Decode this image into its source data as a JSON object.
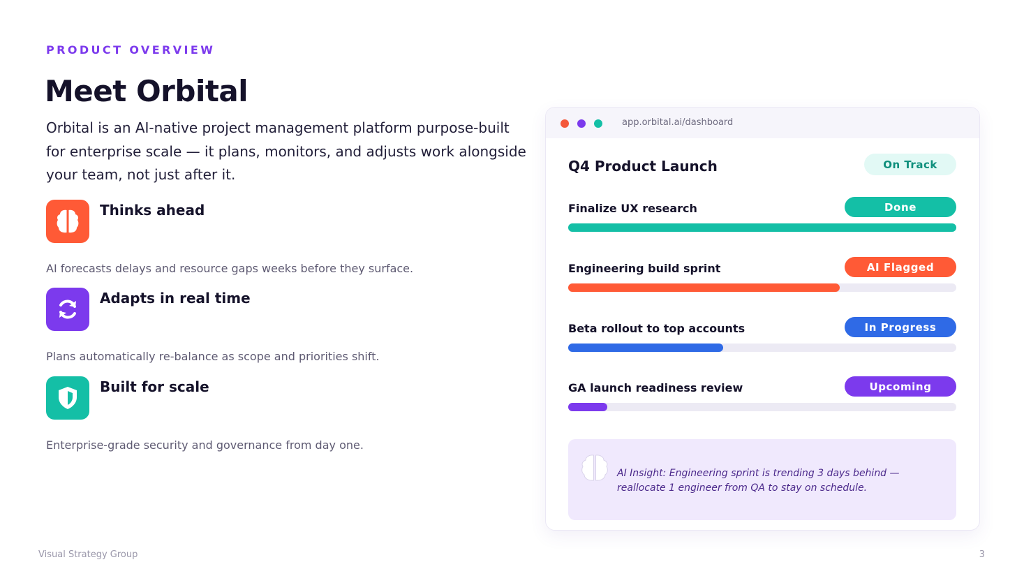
{
  "eyebrow": "PRODUCT OVERVIEW",
  "title": "Meet Orbital",
  "intro": "Orbital is an AI-native project management platform purpose-built for enterprise scale — it plans, monitors, and adjusts work alongside your team, not just after it.",
  "features": [
    {
      "title": "Thinks ahead",
      "desc": "AI forecasts delays and resource gaps weeks before they surface.",
      "icon": "brain-icon",
      "color": "#ff5a36"
    },
    {
      "title": "Adapts in real time",
      "desc": "Plans automatically re-balance as scope and priorities shift.",
      "icon": "refresh-icon",
      "color": "#7c3aed"
    },
    {
      "title": "Built for scale",
      "desc": "Enterprise-grade security and governance from day one.",
      "icon": "shield-icon",
      "color": "#14bfa6"
    }
  ],
  "dashboard": {
    "url": "app.orbital.ai/dashboard",
    "window_dots": [
      "#f4583a",
      "#7c3aed",
      "#14bfa6"
    ],
    "project_title": "Q4 Product Launch",
    "project_status": "On Track",
    "tasks": [
      {
        "name": "Finalize UX research",
        "status": "Done",
        "color": "#14bfa6",
        "progress": 1.0
      },
      {
        "name": "Engineering build sprint",
        "status": "AI Flagged",
        "color": "#ff5a36",
        "progress": 0.7
      },
      {
        "name": "Beta rollout to top accounts",
        "status": "In Progress",
        "color": "#2f6ae6",
        "progress": 0.4
      },
      {
        "name": "GA launch readiness review",
        "status": "Upcoming",
        "color": "#7c3aed",
        "progress": 0.1
      }
    ],
    "insight": {
      "icon": "brain-icon",
      "text": "AI Insight: Engineering sprint is trending 3 days behind — reallocate 1 engineer from QA to stay on schedule."
    }
  },
  "footer": {
    "left": "Visual Strategy Group",
    "right": "3"
  }
}
